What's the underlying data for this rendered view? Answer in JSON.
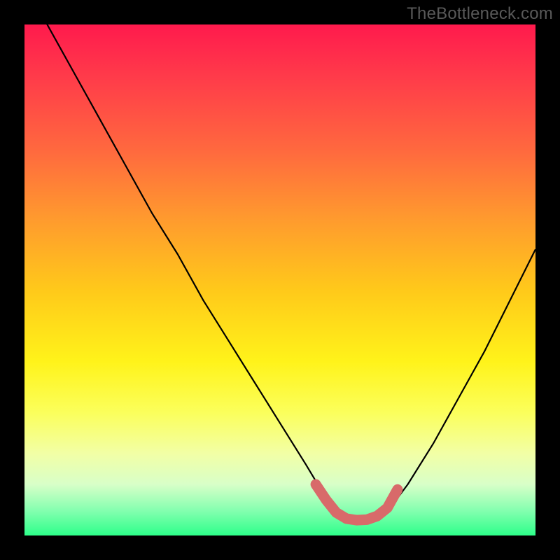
{
  "attribution": "TheBottleneck.com",
  "colors": {
    "page_bg": "#000000",
    "gradient_top": "#ff1a4d",
    "gradient_mid": "#fff31a",
    "gradient_bottom": "#2dff8a",
    "curve_stroke": "#000000",
    "highlight_stroke": "#e57373"
  },
  "chart_data": {
    "type": "line",
    "title": "",
    "xlabel": "",
    "ylabel": "",
    "xlim": [
      0,
      100
    ],
    "ylim": [
      0,
      100
    ],
    "grid": false,
    "series": [
      {
        "name": "curve",
        "x": [
          0,
          5,
          10,
          15,
          20,
          25,
          30,
          35,
          40,
          45,
          50,
          55,
          58,
          60,
          62,
          64,
          66,
          68,
          70,
          72,
          75,
          80,
          85,
          90,
          95,
          100
        ],
        "y": [
          108,
          99,
          90,
          81,
          72,
          63,
          55,
          46,
          38,
          30,
          22,
          14,
          9,
          6,
          4,
          3,
          3,
          3,
          4,
          6,
          10,
          18,
          27,
          36,
          46,
          56
        ]
      }
    ],
    "highlights": [
      {
        "name": "floor-segment",
        "x": [
          57,
          59,
          61,
          63,
          65,
          67,
          69,
          71,
          73
        ],
        "y": [
          10,
          7,
          4.5,
          3.3,
          3,
          3.1,
          3.8,
          5.4,
          9
        ]
      }
    ]
  }
}
